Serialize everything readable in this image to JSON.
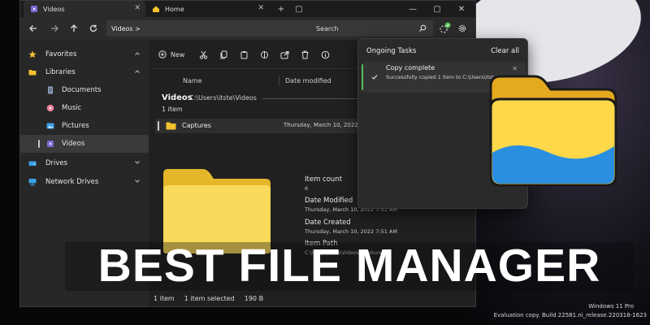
{
  "tabs": [
    {
      "label": "Videos",
      "icon": "videos-folder-icon"
    },
    {
      "label": "Home",
      "icon": "home-icon"
    }
  ],
  "address": "Videos >",
  "search_placeholder": "Search",
  "sidebar": {
    "items": [
      {
        "label": "Favorites",
        "icon": "star-icon"
      },
      {
        "label": "Libraries",
        "icon": "folder-icon"
      },
      {
        "label": "Documents",
        "icon": "documents-icon"
      },
      {
        "label": "Music",
        "icon": "music-icon"
      },
      {
        "label": "Pictures",
        "icon": "pictures-icon"
      },
      {
        "label": "Videos",
        "icon": "videos-icon"
      },
      {
        "label": "Drives",
        "icon": "drive-icon"
      },
      {
        "label": "Network Drives",
        "icon": "network-drive-icon"
      }
    ]
  },
  "toolbar": {
    "new_label": "New"
  },
  "columns": {
    "name": "Name",
    "date_modified": "Date modified"
  },
  "folder": {
    "title": "Videos",
    "path": "C:\\Users\\itste\\Videos",
    "count": "1 item"
  },
  "rows": [
    {
      "name": "Captures",
      "date": "Thursday, March 10, 2022"
    }
  ],
  "properties": [
    {
      "label": "Item count",
      "value": "6"
    },
    {
      "label": "Date Modified",
      "value": "Thursday, March 10, 2022 7:51 AM"
    },
    {
      "label": "Date Created",
      "value": "Thursday, March 10, 2022 7:51 AM"
    },
    {
      "label": "Item Path",
      "value": "C:\\Users\\itste\\Videos\\Captures"
    }
  ],
  "status": {
    "count": "1 item",
    "selected": "1 item selected",
    "size": "190 B"
  },
  "tasks": {
    "title": "Ongoing Tasks",
    "clear": "Clear all",
    "card_title": "Copy complete",
    "card_message": "Successfully copied 1 item to C:\\Users\\itste\\AppData\\Roaming\\Microsoft\\Windows"
  },
  "headline": "BEST FILE MANAGER",
  "watermark": {
    "line1": "Windows 11 Pro",
    "line2": "Evaluation copy. Build 22581.ni_release.220318-1623"
  },
  "colors": {
    "accent_green": "#52c05a",
    "folder_yellow": "#f6cf3a",
    "folder_blue": "#2a8fe0"
  }
}
